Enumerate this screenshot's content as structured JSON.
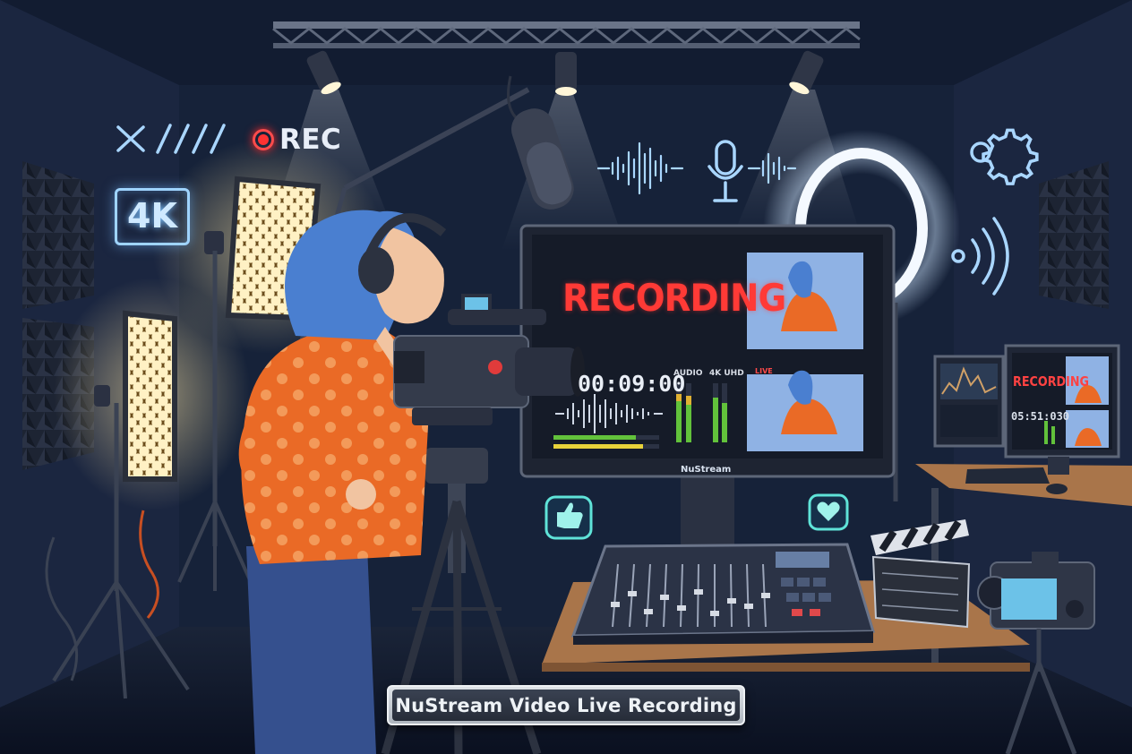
{
  "overlay": {
    "rec_label": "REC",
    "badge_4k": "4K"
  },
  "main_monitor": {
    "recording_text": "RECORDING",
    "timecode": "00:09:00",
    "audio_label": "AUDIO",
    "uhd_label": "4K UHD",
    "live_tag": "LIVE",
    "brand": "NuStream"
  },
  "side_monitor": {
    "recording_text": "RECORDING",
    "timecode": "05:51:030"
  },
  "caption": {
    "text": "NuStream Video Live Recording"
  },
  "colors": {
    "rec_red": "#ff3a36",
    "neon_blue": "#9fd4ff",
    "sweater_orange": "#ea6a26",
    "hair_blue": "#4a7fd0",
    "ring_light": "#f2f8ff"
  },
  "icons": [
    "close-icon",
    "slash-lines-icon",
    "record-icon",
    "microphone-icon",
    "waveform-icon",
    "gear-icon",
    "wireless-signal-icon",
    "thumbs-up-icon",
    "heart-icon"
  ]
}
